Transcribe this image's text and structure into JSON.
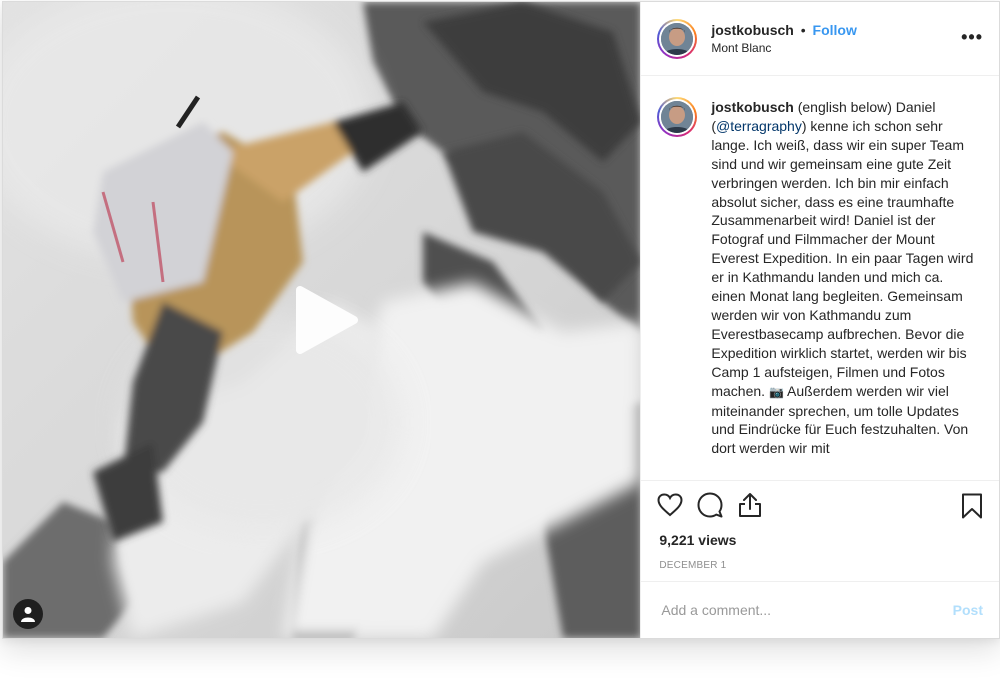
{
  "post": {
    "username": "jostkobusch",
    "follow_label": "Follow",
    "separator": "•",
    "location": "Mont Blanc",
    "more_label": "•••"
  },
  "caption": {
    "username": "jostkobusch",
    "part1": " (english below) Daniel (",
    "mention": "@terragraphy",
    "part2": ") kenne ich schon sehr lange. Ich weiß, dass wir ein super Team sind und wir gemeinsam eine gute Zeit verbringen werden. Ich bin mir einfach absolut sicher, dass es eine traumhafte Zusammenarbeit wird! Daniel ist der Fotograf und Filmmacher der Mount Everest Expedition. In ein paar Tagen wird er in Kathmandu landen und mich ca. einen Monat lang begleiten. Gemeinsam werden wir von Kathmandu zum Everestbasecamp aufbrechen. Bevor die Expedition wirklich startet, werden wir bis Camp 1 aufsteigen, Filmen und Fotos machen. ",
    "camera_emoji": "📷",
    "part3": " Außerdem werden wir viel miteinander sprechen, um tolle Updates und Eindrücke für Euch festzuhalten. Von dort werden wir mit"
  },
  "stats": {
    "views": "9,221 views",
    "date": "DECEMBER 1"
  },
  "comment": {
    "placeholder": "Add a comment...",
    "post_label": "Post"
  },
  "icons": {
    "like": "heart-icon",
    "comment": "comment-bubble-icon",
    "share": "share-icon",
    "save": "bookmark-icon",
    "play": "play-icon",
    "user_tag": "user-tag-icon"
  },
  "colors": {
    "follow": "#3897f0",
    "mention": "#003569",
    "post_disabled": "#b2dffc",
    "text": "#262626",
    "muted": "#8e8e8e"
  }
}
